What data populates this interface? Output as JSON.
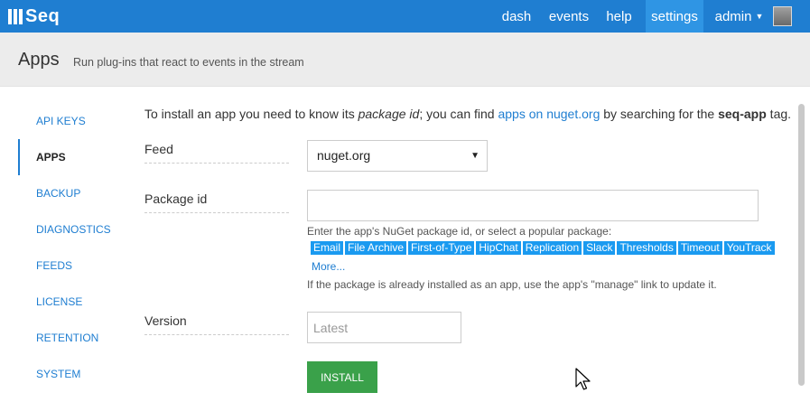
{
  "brand": {
    "logo_text": "Seq"
  },
  "nav": {
    "dash": "dash",
    "events": "events",
    "help": "help",
    "settings": "settings",
    "admin": "admin",
    "caret": "▼"
  },
  "header": {
    "title": "Apps",
    "subtitle": "Run plug-ins that react to events in the stream"
  },
  "sidebar": {
    "items": [
      {
        "label": "API KEYS",
        "active": false
      },
      {
        "label": "APPS",
        "active": true
      },
      {
        "label": "BACKUP",
        "active": false
      },
      {
        "label": "DIAGNOSTICS",
        "active": false
      },
      {
        "label": "FEEDS",
        "active": false
      },
      {
        "label": "LICENSE",
        "active": false
      },
      {
        "label": "RETENTION",
        "active": false
      },
      {
        "label": "SYSTEM",
        "active": false
      }
    ]
  },
  "intro": {
    "text1": "To install an app you need to know its ",
    "em": "package id",
    "text2": "; you can find ",
    "link": "apps on nuget.org",
    "text3": " by searching for the ",
    "strong": "seq-app",
    "text4": " tag."
  },
  "form": {
    "feed_label": "Feed",
    "feed_value": "nuget.org",
    "package_label": "Package id",
    "package_value": "",
    "package_hint": "Enter the app's NuGet package id, or select a popular package:",
    "popular_packages": [
      "Email",
      "File Archive",
      "First-of-Type",
      "HipChat",
      "Replication",
      "Slack",
      "Thresholds",
      "Timeout",
      "YouTrack"
    ],
    "more_label": "More...",
    "installed_note": "If the package is already installed as an app, use the app's \"manage\" link to update it.",
    "version_label": "Version",
    "version_placeholder": "Latest",
    "install_label": "INSTALL"
  },
  "colors": {
    "topbar": "#1f7ed1",
    "settings_active": "#2f95e4",
    "tag": "#1a9af0",
    "install": "#3aa14a",
    "header_bg": "#ececec"
  },
  "icons": {
    "dropdown": "chevron-down-icon",
    "cursor": "mouse-cursor-icon"
  }
}
